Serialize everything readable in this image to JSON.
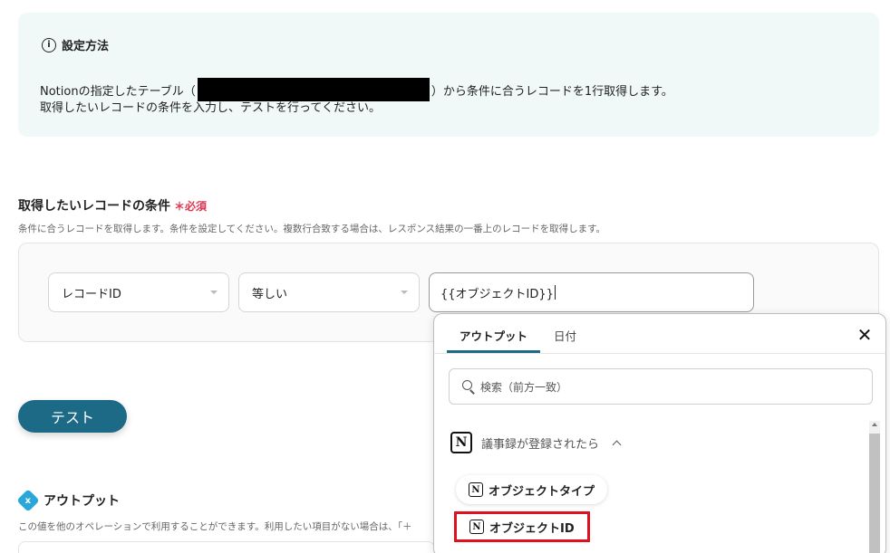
{
  "setup": {
    "title": "設定方法",
    "line1_pre": "Notionの指定したテーブル（",
    "line1_post": "）から条件に合うレコードを1行取得します。",
    "line2": "取得したいレコードの条件を入力し、テストを行ってください。"
  },
  "condition": {
    "label": "取得したいレコードの条件",
    "required": "＊必須",
    "help": "条件に合うレコードを取得します。条件を設定してください。複数行合致する場合は、レスポンス結果の一番上のレコードを取得します。",
    "field_select": "レコードID",
    "operator_select": "等しい",
    "value": "{{オブジェクトID}}"
  },
  "test_button": "テスト",
  "output": {
    "title": "アウトプット",
    "icon_letter": "x",
    "help": "この値を他のオペレーションで利用することができます。利用したい項目がない場合は、「＋"
  },
  "popup": {
    "tabs": [
      "アウトプット",
      "日付"
    ],
    "search_placeholder": "検索（前方一致）",
    "group_label": "議事録が登録されたら",
    "items": [
      "オブジェクトタイプ",
      "オブジェクトID"
    ],
    "notion_letter": "N",
    "close": "✕"
  },
  "colors": {
    "accent": "#1c6a85",
    "info_bg": "#f1f9f8",
    "required": "#e0364f",
    "highlight": "#e0101e"
  }
}
